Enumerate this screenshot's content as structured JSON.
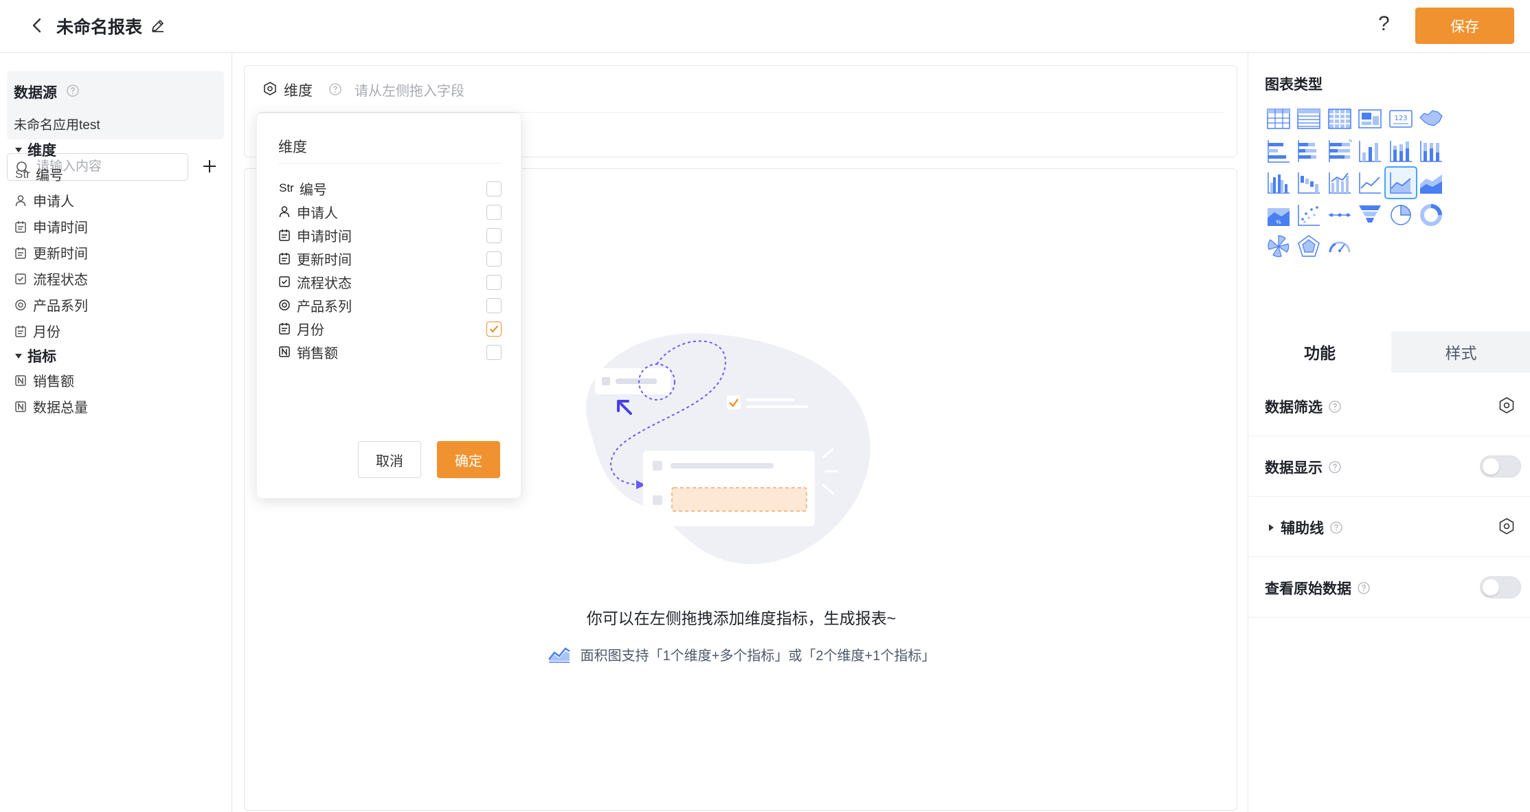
{
  "header": {
    "title": "未命名报表",
    "help": "?",
    "save_label": "保存"
  },
  "left": {
    "datasource_title": "数据源",
    "datasource_app": "未命名应用test",
    "search_placeholder": "请输入内容",
    "dim_group": "维度",
    "metric_group": "指标",
    "dimensions": [
      {
        "type": "Str",
        "icon": "string-icon",
        "label": "编号"
      },
      {
        "type": "user",
        "icon": "user-icon",
        "label": "申请人"
      },
      {
        "type": "date",
        "icon": "calendar-icon",
        "label": "申请时间"
      },
      {
        "type": "date",
        "icon": "calendar-icon",
        "label": "更新时间"
      },
      {
        "type": "check",
        "icon": "checkbox-icon",
        "label": "流程状态"
      },
      {
        "type": "radio",
        "icon": "radio-icon",
        "label": "产品系列"
      },
      {
        "type": "date",
        "icon": "calendar-icon",
        "label": "月份"
      }
    ],
    "metrics": [
      {
        "type": "num",
        "icon": "number-icon",
        "label": "销售额"
      },
      {
        "type": "num",
        "icon": "number-icon",
        "label": "数据总量"
      }
    ]
  },
  "center": {
    "dim_label": "维度",
    "dim_placeholder": "请从左侧拖入字段",
    "empty_main": "你可以在左侧拖拽添加维度指标，生成报表~",
    "empty_sub": "面积图支持「1个维度+多个指标」或「2个维度+1个指标」"
  },
  "popup": {
    "title": "维度",
    "options": [
      {
        "type": "Str",
        "label": "编号",
        "checked": false
      },
      {
        "type": "user",
        "label": "申请人",
        "checked": false
      },
      {
        "type": "date",
        "label": "申请时间",
        "checked": false
      },
      {
        "type": "date",
        "label": "更新时间",
        "checked": false
      },
      {
        "type": "check",
        "label": "流程状态",
        "checked": false
      },
      {
        "type": "radio",
        "label": "产品系列",
        "checked": false
      },
      {
        "type": "date",
        "label": "月份",
        "checked": true
      },
      {
        "type": "num",
        "label": "销售额",
        "checked": false
      }
    ],
    "cancel_label": "取消",
    "ok_label": "确定"
  },
  "right": {
    "chart_type_title": "图表类型",
    "chart_types": [
      "table-icon",
      "detail-table-icon",
      "pivot-table-icon",
      "card-icon",
      "kpi-number-icon",
      "map-icon",
      "bar-horizontal-icon",
      "bar-horizontal-stacked-icon",
      "bar-horizontal-percent-icon",
      "column-icon",
      "column-stacked-icon",
      "column-percent-icon",
      "column-grouped-icon",
      "waterfall-icon",
      "bar-line-combo-icon",
      "line-icon",
      "area-icon",
      "area-stacked-icon",
      "area-percent-icon",
      "scatter-icon",
      "dot-line-icon",
      "funnel-icon",
      "pie-icon",
      "donut-icon",
      "rose-icon",
      "radar-icon",
      "gauge-icon"
    ],
    "selected_chart_index": 16,
    "tab_function": "功能",
    "tab_style": "样式",
    "rows": [
      {
        "label": "数据筛选",
        "control": "gear",
        "expandable": false
      },
      {
        "label": "数据显示",
        "control": "toggle",
        "expandable": false,
        "value": false
      },
      {
        "label": "辅助线",
        "control": "gear",
        "expandable": true
      },
      {
        "label": "查看原始数据",
        "control": "toggle",
        "expandable": false,
        "value": false
      }
    ]
  },
  "colors": {
    "accent": "#f0922f",
    "chart_blue": "#4a7ff0",
    "selected_border": "#4aa3f5"
  }
}
